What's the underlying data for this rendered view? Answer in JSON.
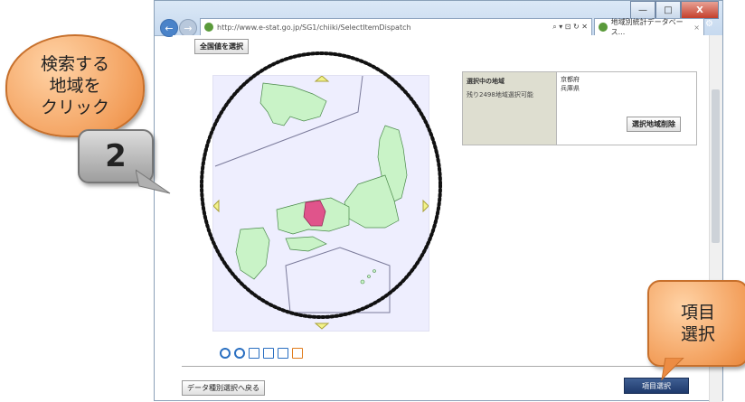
{
  "browser": {
    "url": "http://www.e-stat.go.jp/SG1/chiiki/SelectItemDispatch",
    "address_tools": "⌕ ▾ ⊡ ↻ ✕",
    "tab_title": "地域別統計データベース...",
    "tab_close": "×",
    "back_icon": "←",
    "forward_icon": "→",
    "right_icons": "⌂ ★ ⚙",
    "window_minimize": "—",
    "window_maximize": "□",
    "window_close": "X"
  },
  "page": {
    "select_all_button": "全国値を選択",
    "selected_area_header": "選択中の地域",
    "selectable_note": "残り2498地域選択可能",
    "selected_regions": [
      "京都府",
      "兵庫県"
    ],
    "remove_selected_button": "選択地域削除",
    "back_to_datatype_link": "データ種別選択へ戻る",
    "item_select_button": "項目選択"
  },
  "map": {
    "highlight_color": "#e0548b",
    "land_color": "#c9f3c7",
    "background_color": "#eeeefe"
  },
  "annotations": {
    "callout_search": "検索する\n地域を\nクリック",
    "badge_number": "2",
    "callout_item": "項目\n選択",
    "callout_color": "#f3a05d"
  }
}
